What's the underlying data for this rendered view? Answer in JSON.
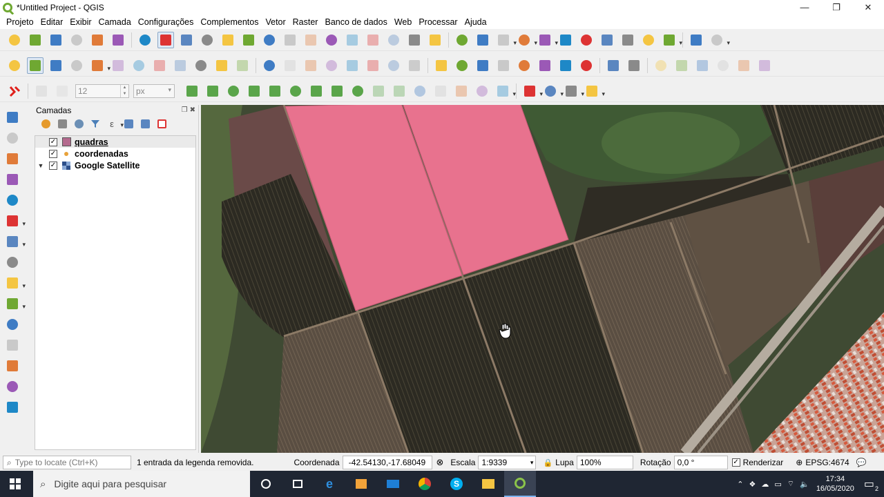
{
  "window": {
    "title": "*Untitled Project - QGIS",
    "minimize": "—",
    "maximize": "❐",
    "close": "✕"
  },
  "menu": [
    "Projeto",
    "Editar",
    "Exibir",
    "Camada",
    "Configurações",
    "Complementos",
    "Vetor",
    "Raster",
    "Banco de dados",
    "Web",
    "Processar",
    "Ajuda"
  ],
  "digitize": {
    "size_value": "12",
    "unit_value": "px"
  },
  "layers_panel": {
    "title": "Camadas",
    "layers": [
      {
        "name": "quadras",
        "checked": "✓",
        "type": "polygon"
      },
      {
        "name": "coordenadas",
        "checked": "✓",
        "type": "point"
      },
      {
        "name": "Google Satellite",
        "checked": "✓",
        "type": "raster"
      }
    ],
    "expand_arrow": "▼"
  },
  "status": {
    "locate_placeholder": "Type to locate (Ctrl+K)",
    "message": "1 entrada da legenda removida.",
    "coord_label": "Coordenada",
    "coord_value": "-42.54130,-17.68049",
    "scale_label": "Escala",
    "scale_value": "1:9339",
    "magnifier_label": "Lupa",
    "magnifier_value": "100%",
    "rotation_label": "Rotação",
    "rotation_value": "0,0 °",
    "render_label": "Renderizar",
    "crs": "EPSG:4674"
  },
  "taskbar": {
    "search_placeholder": "Digite aqui para pesquisar",
    "time": "17:34",
    "date": "16/05/2020",
    "notifications": "2"
  },
  "colors": {
    "polygon_fill": "#e8728e",
    "accent": "#6fa832"
  },
  "icons": {
    "toolbar1": [
      "new-project-icon",
      "open-project-icon",
      "save-project-icon",
      "save-as-icon",
      "new-print-layout-icon",
      "layout-manager-icon",
      "style-manager-icon",
      "pan-icon",
      "pan-to-selection-icon",
      "zoom-in-icon",
      "zoom-out-icon",
      "zoom-full-icon",
      "zoom-selection-icon",
      "zoom-layer-icon",
      "zoom-native-icon",
      "zoom-last-icon",
      "zoom-next-icon",
      "new-map-view-icon",
      "new-3d-view-icon",
      "bookmark-new-icon",
      "bookmarks-icon",
      "refresh-icon",
      "identify-icon",
      "measure-icon",
      "select-icon",
      "select-by-value-icon",
      "deselect-icon",
      "attribute-table-icon",
      "field-calculator-icon",
      "toolbox-icon",
      "statistics-icon",
      "ruler-icon",
      "map-tip-icon",
      "text-annotation-icon"
    ],
    "toolbar2": [
      "edit-pencil-icon",
      "toggle-edit-icon",
      "save-edits-icon",
      "add-feature-icon",
      "vertex-tool-icon",
      "modify-attributes-icon",
      "delete-selected-icon",
      "cut-features-icon",
      "copy-features-icon",
      "paste-features-icon",
      "undo-icon",
      "redo-icon",
      "label-icon",
      "rule-label-icon",
      "label-toolbar-icon",
      "pin-labels-icon",
      "show-labels-icon",
      "move-label-icon",
      "rotate-label-icon",
      "change-label-icon",
      "shield-icon",
      "db-manager-icon",
      "database-icon",
      "warning-triangle-icon",
      "globe-grid-icon",
      "globe-arrow-icon",
      "globe-gear-icon",
      "python-icon",
      "help-icon",
      "plugin-icon",
      "offset-1-icon",
      "offset-2-icon",
      "offset-3-icon",
      "offset-4-icon",
      "offset-5-icon",
      "offset-6-icon"
    ],
    "toolbar3": [
      "snapping-icon",
      "cad-icon",
      "cad-constraint-icon"
    ],
    "left_toolbar": [
      "add-vector-layer-icon",
      "add-raster-layer-icon",
      "add-mesh-layer-icon",
      "add-delimited-icon",
      "add-geopackage-icon",
      "add-postgis-icon",
      "add-wms-icon",
      "add-wfs-icon",
      "add-wcs-icon",
      "add-virtual-icon",
      "new-geopackage-icon",
      "new-shapefile-icon",
      "new-temporary-icon",
      "new-spatialite-icon",
      "new-virtual-icon"
    ]
  }
}
